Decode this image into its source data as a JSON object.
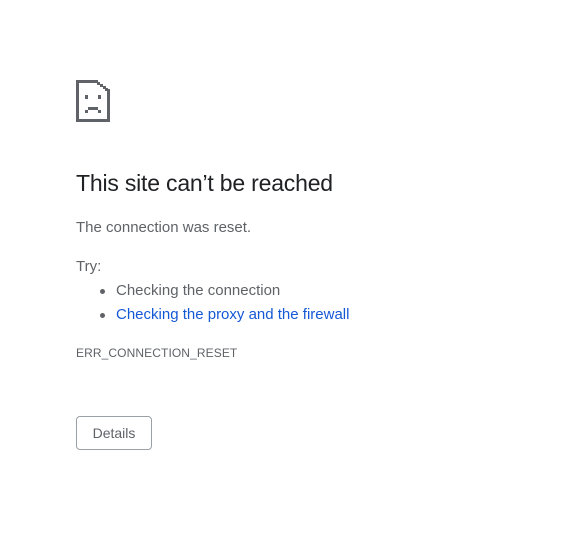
{
  "error": {
    "icon": "sad-page-icon",
    "title": "This site can’t be reached",
    "summary": "The connection was reset.",
    "try_label": "Try:",
    "suggestions": [
      {
        "label": "Checking the connection",
        "is_link": false
      },
      {
        "label": "Checking the proxy and the firewall",
        "is_link": true
      }
    ],
    "code": "ERR_CONNECTION_RESET",
    "details_button": "Details"
  },
  "colors": {
    "title": "#202124",
    "text": "#5f6368",
    "link": "#1558d6",
    "icon": "#5f6368"
  }
}
